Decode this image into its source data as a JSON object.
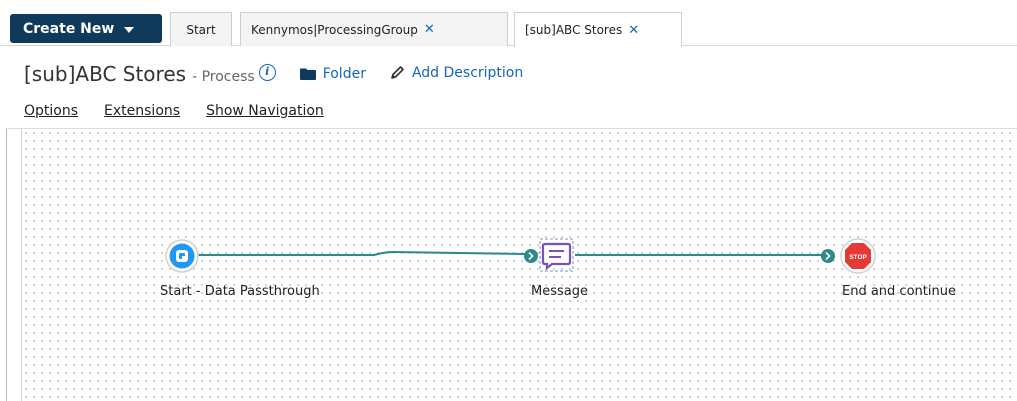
{
  "toolbar": {
    "create_new_label": "Create New"
  },
  "tabs": [
    {
      "label": "Start",
      "closable": false
    },
    {
      "label": "Kennymos|ProcessingGroup",
      "closable": true
    },
    {
      "label": "[sub]ABC Stores",
      "closable": true,
      "active": true
    }
  ],
  "header": {
    "title": "[sub]ABC Stores",
    "subtitle": "- Process",
    "info_icon": "i",
    "folder_label": "Folder",
    "add_description_label": "Add Description"
  },
  "menu": {
    "options": "Options",
    "extensions": "Extensions",
    "show_navigation": "Show Navigation"
  },
  "flow": {
    "nodes": [
      {
        "label": "Start - Data Passthrough",
        "icon": "start-connector-icon"
      },
      {
        "label": "Message",
        "icon": "message-icon"
      },
      {
        "label": "End and continue",
        "icon": "stop-icon",
        "badge_text": "STOP"
      }
    ],
    "colors": {
      "connector": "#2d8a8a",
      "start": "#2196f3",
      "message": "#7b4fc4",
      "stop": "#e53935",
      "accent": "#0f3a5b",
      "link": "#1565c0"
    }
  },
  "close_glyph": "✕"
}
